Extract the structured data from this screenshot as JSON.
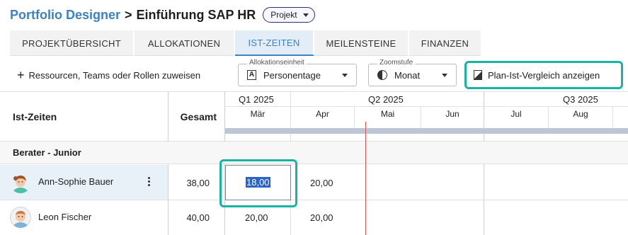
{
  "header": {
    "app_name": "Portfolio Designer",
    "separator": ">",
    "project_title": "Einführung SAP HR",
    "badge_label": "Projekt"
  },
  "tabs": [
    {
      "label": "PROJEKTÜBERSICHT",
      "active": false
    },
    {
      "label": "ALLOKATIONEN",
      "active": false
    },
    {
      "label": "IST-ZEITEN",
      "active": true
    },
    {
      "label": "MEILENSTEINE",
      "active": false
    },
    {
      "label": "FINANZEN",
      "active": false
    }
  ],
  "toolbar": {
    "add_resources_label": "Ressourcen, Teams oder Rollen zuweisen",
    "allocation_unit": {
      "legend": "Allokationseinheit",
      "value": "Personentage",
      "icon": "letter-a-box-icon"
    },
    "zoom_level": {
      "legend": "Zoomstufe",
      "value": "Monat",
      "icon": "half-circle-icon"
    },
    "compare_button_label": "Plan-Ist-Vergleich anzeigen"
  },
  "grid": {
    "header_name": "Ist-Zeiten",
    "header_total": "Gesamt",
    "quarters": [
      "Q1 2025",
      "Q2 2025",
      "Q3 2025"
    ],
    "months": [
      "Mär",
      "Apr",
      "Mai",
      "Jun",
      "Jul",
      "Aug"
    ],
    "group_label": "Berater - Junior",
    "rows": [
      {
        "name": "Ann-Sophie Bauer",
        "total": "38,00",
        "values": [
          "18,00",
          "20,00"
        ]
      },
      {
        "name": "Leon Fischer",
        "total": "40,00",
        "values": [
          "20,00",
          "20,00"
        ]
      }
    ]
  },
  "colors": {
    "accent": "#3b82c4",
    "highlight": "#18b3a3",
    "today_line": "#d9534f",
    "timeline_bar": "#bcc6d6"
  }
}
